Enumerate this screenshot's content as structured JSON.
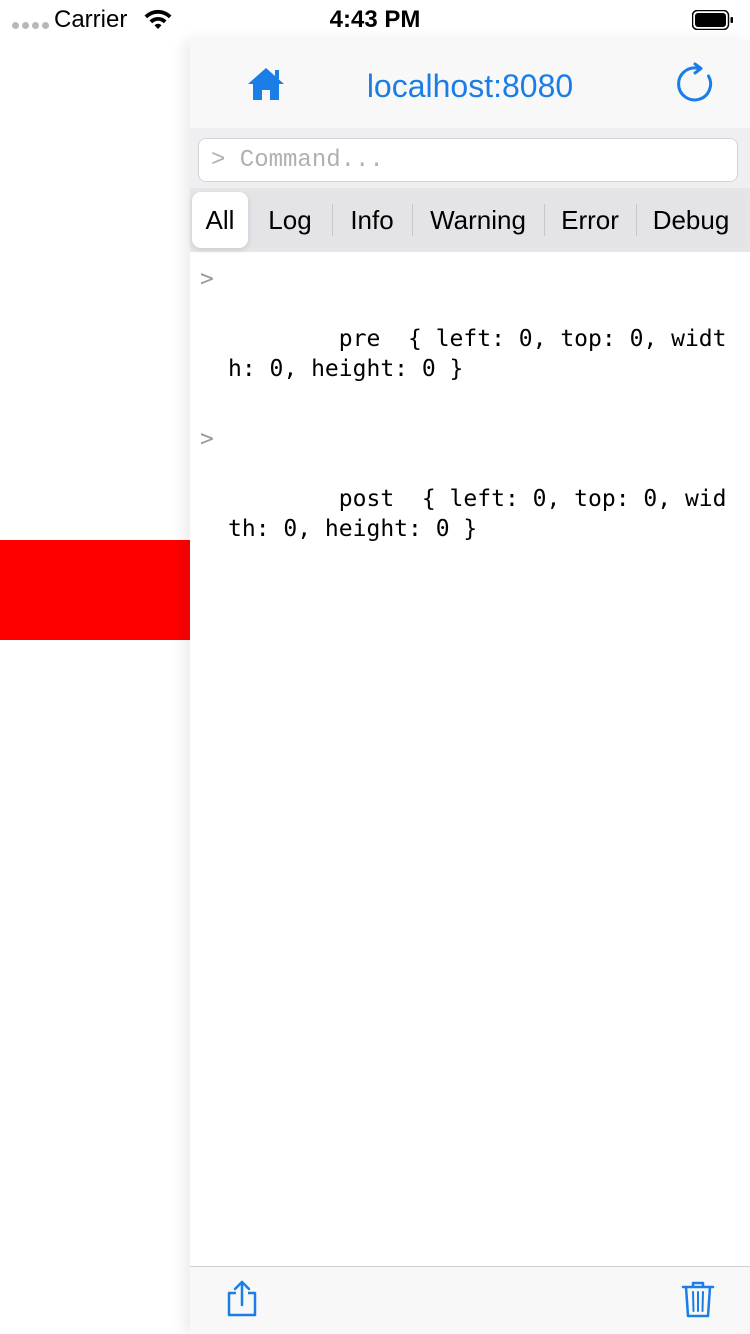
{
  "status_bar": {
    "carrier": "Carrier",
    "time": "4:43 PM"
  },
  "colors": {
    "accent": "#1a7ee6",
    "red_block": "#ff0000"
  },
  "console": {
    "title": "localhost:8080",
    "command_placeholder": "> Command...",
    "filters": [
      "All",
      "Log",
      "Info",
      "Warning",
      "Error",
      "Debug"
    ],
    "selected_filter": "All",
    "logs": [
      {
        "prompt": ">",
        "text": "pre  { left: 0, top: 0, width: 0, height: 0 }"
      },
      {
        "prompt": ">",
        "text": "post  { left: 0, top: 0, width: 0, height: 0 }"
      }
    ],
    "icons": {
      "home": "home-icon",
      "reload": "reload-icon",
      "share": "share-icon",
      "trash": "trash-icon"
    }
  }
}
